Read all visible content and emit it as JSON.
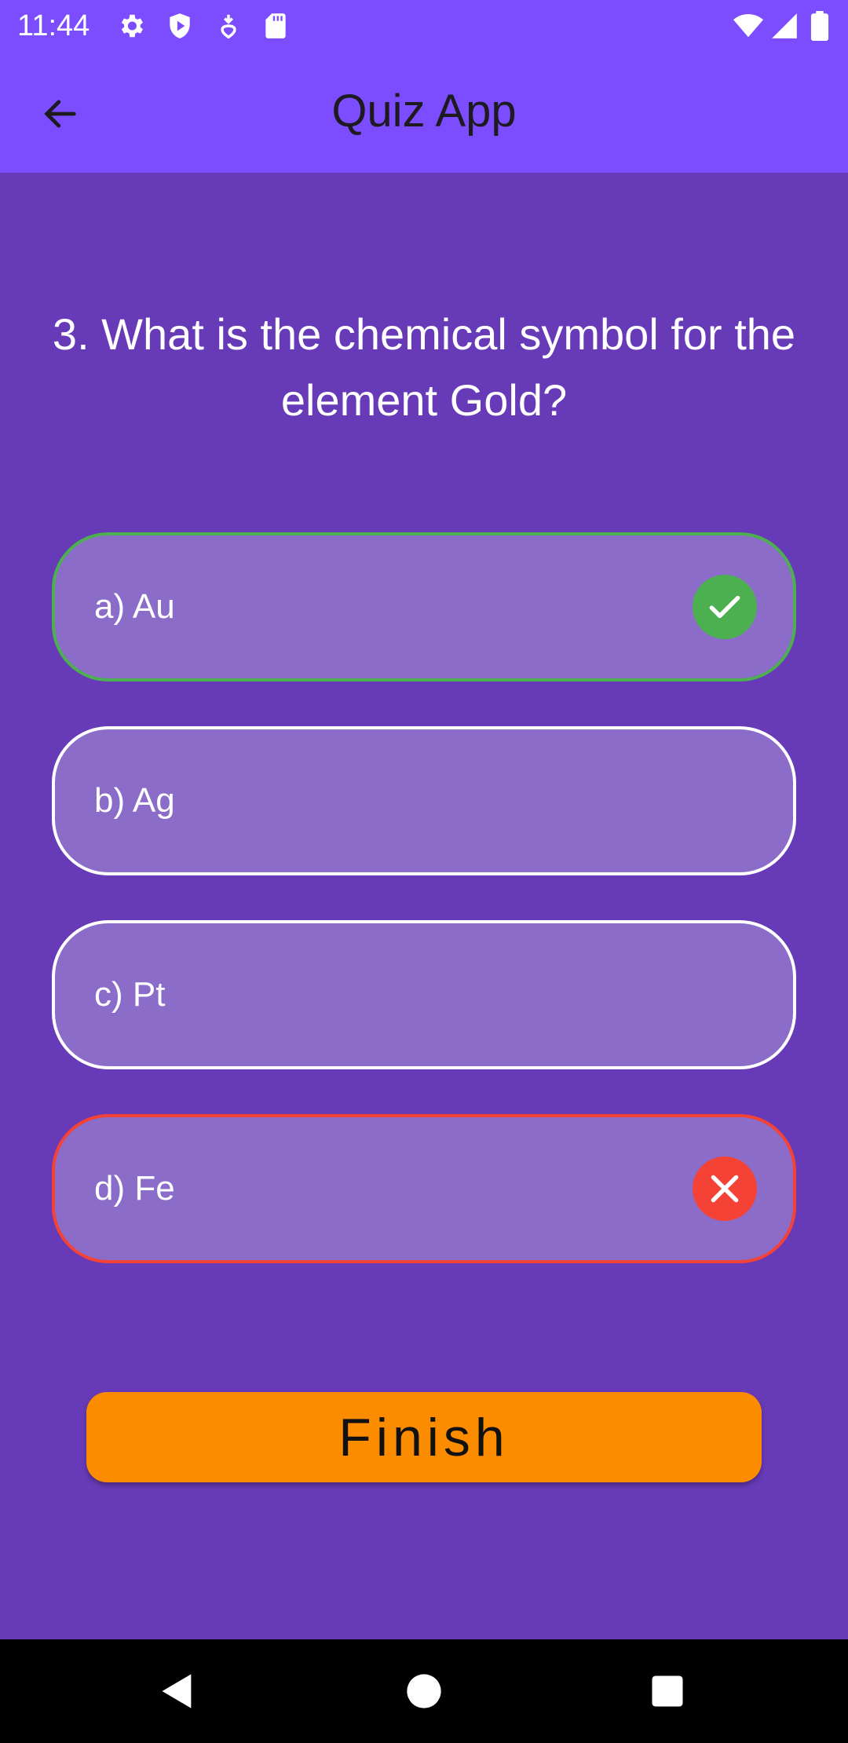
{
  "status_bar": {
    "time": "11:44",
    "left_icons": [
      "gear-icon",
      "shield-icon",
      "download-icon",
      "sd-card-icon"
    ],
    "right_icons": [
      "wifi-icon",
      "signal-icon",
      "battery-icon"
    ]
  },
  "app_bar": {
    "back_icon": "arrow-left-icon",
    "title": "Quiz App"
  },
  "question": {
    "text": "3. What is the chemical symbol for the element Gold?"
  },
  "options": [
    {
      "label": "a) Au",
      "state": "correct",
      "icon": "check-icon"
    },
    {
      "label": "b) Ag",
      "state": "default"
    },
    {
      "label": "c) Pt",
      "state": "default"
    },
    {
      "label": "d) Fe",
      "state": "wrong",
      "icon": "close-icon"
    }
  ],
  "finish_button": {
    "label": "Finish"
  },
  "nav_bar": {
    "icons": [
      "back-triangle-icon",
      "home-circle-icon",
      "recents-square-icon"
    ]
  },
  "colors": {
    "status_bar": "#7c4dff",
    "background": "#673ab7",
    "option_fill": "#8b6cc8",
    "correct": "#4caf50",
    "wrong": "#f44336",
    "finish": "#fb8c00"
  }
}
